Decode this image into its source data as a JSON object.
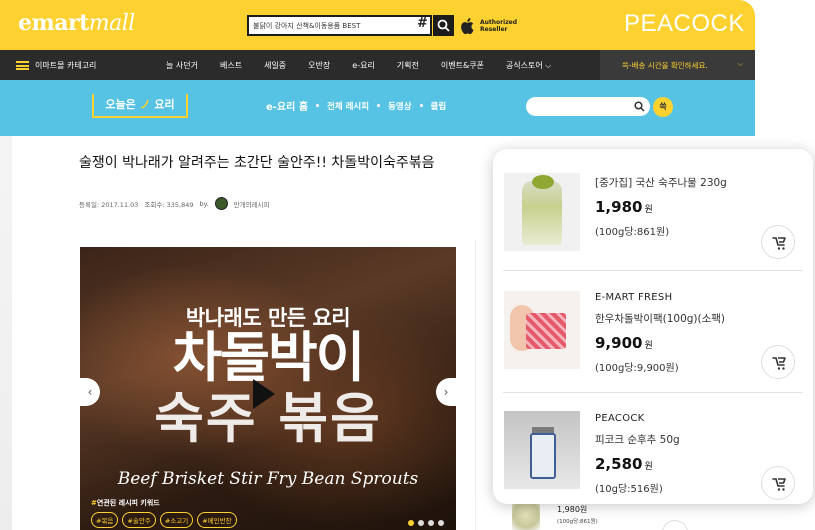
{
  "header": {
    "logo_main": "emart",
    "logo_sub": "mall",
    "search_value": "불닭이 강아지 산책&이동용품 BEST",
    "search_hash": "#",
    "reseller_line1": "Authorized",
    "reseller_line2": "Reseller",
    "peacock": "PEACOCK"
  },
  "nav": {
    "category": "이마트몰 카테고리",
    "items": [
      "늘 사던거",
      "베스트",
      "세일중",
      "오반장",
      "e-요리",
      "기획전",
      "이벤트&쿠폰",
      "공식스토어 ⌵"
    ],
    "delivery": "쓱-배송 시간을 확인하세요.",
    "delivery_chevron": "⌵"
  },
  "recipe_bar": {
    "today": "오늘은",
    "today_mark": "ノ",
    "today_word": "요리",
    "links": [
      "e-요리 홈",
      "전체 레시피",
      "동영상",
      "클립"
    ],
    "search_btn": "쓱"
  },
  "article": {
    "title": "술쟁이 박나래가 알려주는 초간단 술안주!! 차돌박이숙주볶음",
    "date": "등록일: 2017.11.03",
    "views": "조회수: 335,849",
    "by": "by.",
    "author": "만개의레시피"
  },
  "video": {
    "subtitle": "박나래도 만든 요리",
    "title_line1": "차돌박이",
    "title_line2": "숙주 볶음",
    "english": "Beef Brisket Stir Fry Bean Sprouts",
    "keywords_hash": "#",
    "keywords_label": "연관된 레시피 키워드",
    "keywords": [
      "#볶음",
      "#술안주",
      "#소고기",
      "#메인반찬"
    ],
    "prev": "‹",
    "next": "›"
  },
  "behind_item": {
    "price": "1,980원",
    "unit": "(100g당:861원)"
  },
  "popup": {
    "items": [
      {
        "brand": "",
        "name": "[중가집] 국산 숙주나물 230g",
        "price": "1,980",
        "won": "원",
        "unit": "(100g당:861원)"
      },
      {
        "brand": "E-MART FRESH",
        "name": "한우차돌박이팩(100g)(소팩)",
        "price": "9,900",
        "won": "원",
        "unit": "(100g당:9,900원)"
      },
      {
        "brand": "PEACOCK",
        "name": "피코크 순후추 50g",
        "price": "2,580",
        "won": "원",
        "unit": "(10g당:516원)"
      }
    ]
  },
  "colors": {
    "yellow": "#fdd230",
    "nav_dark": "#2b2b2b",
    "recipe_blue": "#56c2e4"
  },
  "icons": [
    "search-icon",
    "apple-icon",
    "hamburger-icon",
    "play-icon",
    "cart-icon"
  ]
}
